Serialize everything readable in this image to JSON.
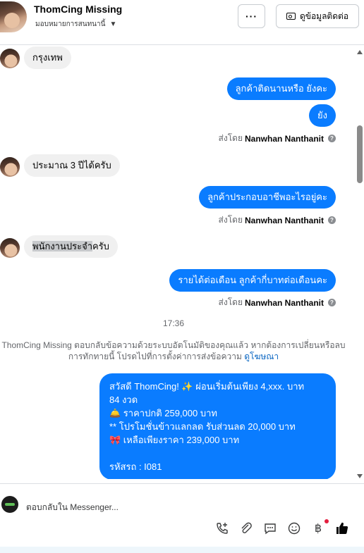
{
  "header": {
    "name": "ThomCing Missing",
    "assign_label": "มอบหมายการสนทนานี้",
    "more_label": "···",
    "contact_button_label": "ดูข้อมูลติดต่อ"
  },
  "messages": {
    "m1": "กรุงเทพ",
    "m2": "ลูกค้าติดนานหรือ ยังคะ",
    "m3": "ยัง",
    "sent_prefix": "ส่งโดย",
    "sent_agent": "Nanwhan Nanthanit",
    "m4": "ประมาณ 3 ปีได้ครับ",
    "m5": "ลูกค้าประกอบอาชีพอะไรอยู่คะ",
    "m6_part1": "พนักงานประจำ",
    "m6_part2": "ครับ",
    "m7": "รายได้ต่อเดือน ลูกค้ากี่บาทต่อเดือนคะ",
    "timestamp": "17:36",
    "notice_line1": "ThomCing Missing ตอบกลับข้อความด้วยระบบอัตโนมัติของคุณแล้ว หากต้องการเปลี่ยนหรือลบ",
    "notice_line2": "การทักทายนี้ โปรดไปที่การตั้งค่าการส่งข้อความ",
    "notice_link": "ดูโฆษณา",
    "auto_reply": {
      "line1": "สวัสดี ThomCing! ✨  ผ่อนเริ่มต้นเพียง 4,xxx. บาท",
      "line2": "84 งวด",
      "line3": "🛎️ ราคาปกติ 259,000 บาท",
      "line4": "** โปรโมชั่นข้าวแลกลด รับส่วนลด 20,000 บาท",
      "line5": "🎀  เหลือเพียงราคา 239,000 บาท",
      "line6": "",
      "line7": "รหัสรถ : I081"
    }
  },
  "composer": {
    "placeholder": "ตอบกลับใน Messenger..."
  }
}
